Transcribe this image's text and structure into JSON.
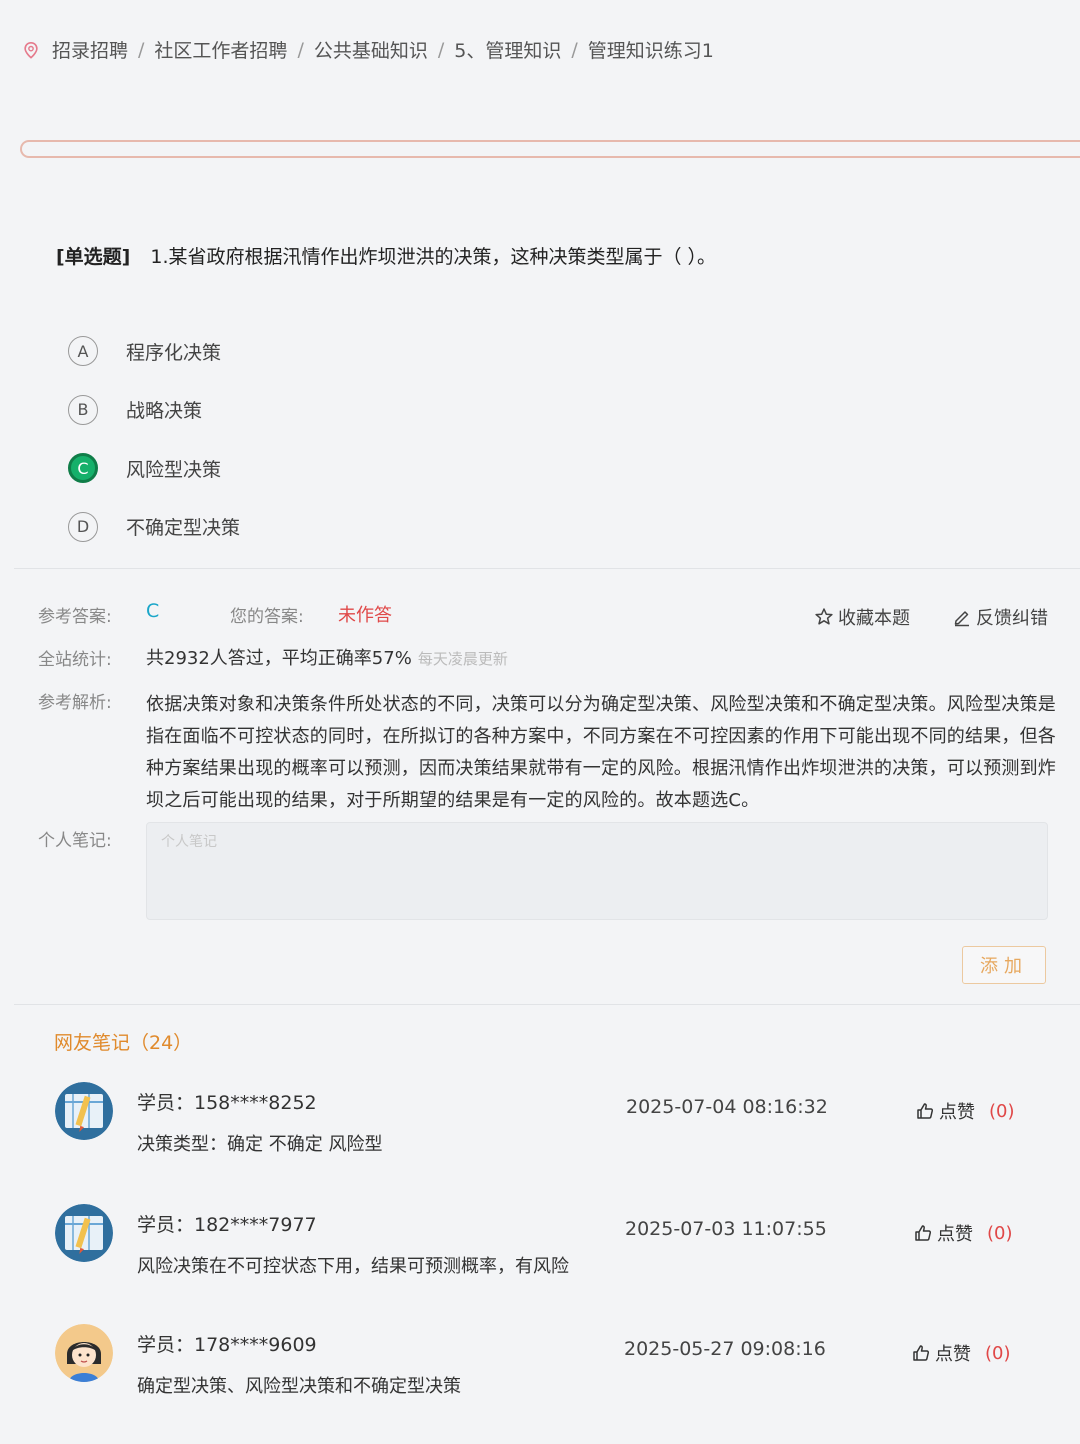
{
  "breadcrumb": {
    "icon": "location-pin-icon",
    "items": [
      "招录招聘",
      "社区工作者招聘",
      "公共基础知识",
      "5、管理知识",
      "管理知识练习1"
    ],
    "separator": "/"
  },
  "question": {
    "type": "[单选题]",
    "text": "1.某省政府根据汛情作出炸坝泄洪的决策，这种决策类型属于（  ）。",
    "options": [
      {
        "letter": "A",
        "text": "程序化决策"
      },
      {
        "letter": "B",
        "text": "战略决策"
      },
      {
        "letter": "C",
        "text": "风险型决策"
      },
      {
        "letter": "D",
        "text": "不确定型决策"
      }
    ],
    "selected": "C"
  },
  "answer": {
    "ref_label": "参考答案:",
    "ref_value": "C",
    "yours_label": "您的答案:",
    "yours_value": "未作答",
    "stats_label": "全站统计:",
    "stats_text": "共2932人答过，平均正确率57%",
    "stats_note": "每天凌晨更新",
    "analysis_label": "参考解析:",
    "analysis_text": "依据决策对象和决策条件所处状态的不同，决策可以分为确定型决策、风险型决策和不确定型决策。风险型决策是指在面临不可控状态的同时，在所拟订的各种方案中，不同方案在不可控因素的作用下可能出现不同的结果，但各种方案结果出现的概率可以预测，因而决策结果就带有一定的风险。根据汛情作出炸坝泄洪的决策，可以预测到炸坝之后可能出现的结果，对于所期望的结果是有一定的风险的。故本题选C。",
    "note_label": "个人笔记:",
    "note_placeholder": "个人笔记",
    "add_button": "添加"
  },
  "actions": {
    "favorite": "收藏本题",
    "favorite_icon": "star-icon",
    "feedback": "反馈纠错",
    "feedback_icon": "pencil-icon"
  },
  "notes": {
    "title": "网友笔记（24）",
    "items": [
      {
        "user": "学员：158****8252",
        "time": "2025-07-04 08:16:32",
        "text": "决策类型：确定 不确定 风险型",
        "like_label": "点赞",
        "like_count": "(0)",
        "avatar": "ruler-pencil-avatar"
      },
      {
        "user": "学员：182****7977",
        "time": "2025-07-03 11:07:55",
        "text": "风险决策在不可控状态下用，结果可预测概率，有风险",
        "like_label": "点赞",
        "like_count": "(0)",
        "avatar": "ruler-pencil-avatar"
      },
      {
        "user": "学员：178****9609",
        "time": "2025-05-27 09:08:16",
        "text": "确定型决策、风险型决策和不确定型决策",
        "like_label": "点赞",
        "like_count": "(0)",
        "avatar": "girl-avatar"
      }
    ]
  },
  "colors": {
    "selected_green": "#15b06a",
    "ref_answer": "#1aa6c9",
    "unanswered_red": "#e04848",
    "notes_title": "#e08a2c"
  }
}
